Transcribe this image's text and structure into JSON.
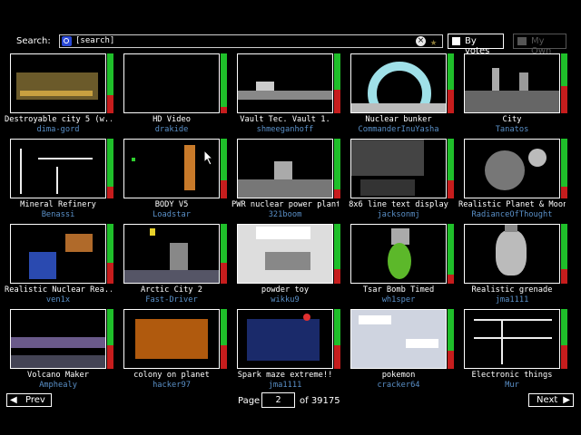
{
  "search": {
    "label": "Search:",
    "value": "[search]"
  },
  "toolbar": {
    "sort_label": "By votes",
    "own_label": "My Own"
  },
  "tiles": [
    {
      "name": "Destroyable city 5 (w...",
      "author": "dima-gord",
      "up": 0.7
    },
    {
      "name": "HD Video",
      "author": "drakide",
      "up": 0.9
    },
    {
      "name": "Vault Tec. Vault 1.",
      "author": "shmeeganhoff",
      "up": 0.6
    },
    {
      "name": "Nuclear bunker",
      "author": "CommanderInuYasha",
      "up": 0.6
    },
    {
      "name": "City",
      "author": "Tanatos",
      "up": 0.55
    },
    {
      "name": "Mineral Refinery",
      "author": "Benassi",
      "up": 0.8
    },
    {
      "name": "BODY V5",
      "author": "Loadstar",
      "up": 0.7
    },
    {
      "name": "PWR nuclear power plant",
      "author": "321boom",
      "up": 0.85
    },
    {
      "name": "8x6 line text display",
      "author": "jacksonmj",
      "up": 0.7
    },
    {
      "name": "Realistic Planet & Moon",
      "author": "RadianceOfThought",
      "up": 0.8
    },
    {
      "name": "Realistic Nuclear Rea...",
      "author": "ven1x",
      "up": 0.65
    },
    {
      "name": "Arctic City 2",
      "author": "Fast-Driver",
      "up": 0.65
    },
    {
      "name": "powder toy",
      "author": "wikku9",
      "up": 0.75
    },
    {
      "name": "Tsar Bomb Timed",
      "author": "wh1sper",
      "up": 0.85
    },
    {
      "name": "Realistic grenade",
      "author": "jma1111",
      "up": 0.75
    },
    {
      "name": "Volcano Maker",
      "author": "Amphealy",
      "up": 0.6
    },
    {
      "name": "colony on planet",
      "author": "hacker97",
      "up": 0.6
    },
    {
      "name": "Spark maze extreme!!",
      "author": "jma1111",
      "up": 0.6
    },
    {
      "name": "pokemon",
      "author": "cracker64",
      "up": 0.7
    },
    {
      "name": "Electronic things",
      "author": "Mur",
      "up": 0.6
    }
  ],
  "pager": {
    "prev_label": "Prev",
    "next_label": "Next",
    "page_label": "Page",
    "page_value": "2",
    "of_label": "of 39175"
  },
  "icons": {
    "search": "magnifier-icon",
    "clear": "clear-icon",
    "favourite": "star-icon",
    "sort": "sort-icon",
    "own": "folder-icon",
    "cursor": "pointer-icon"
  },
  "colors": {
    "vote_up": "#1fbf2a",
    "vote_down": "#c61d1d",
    "author": "#5a90c8"
  }
}
